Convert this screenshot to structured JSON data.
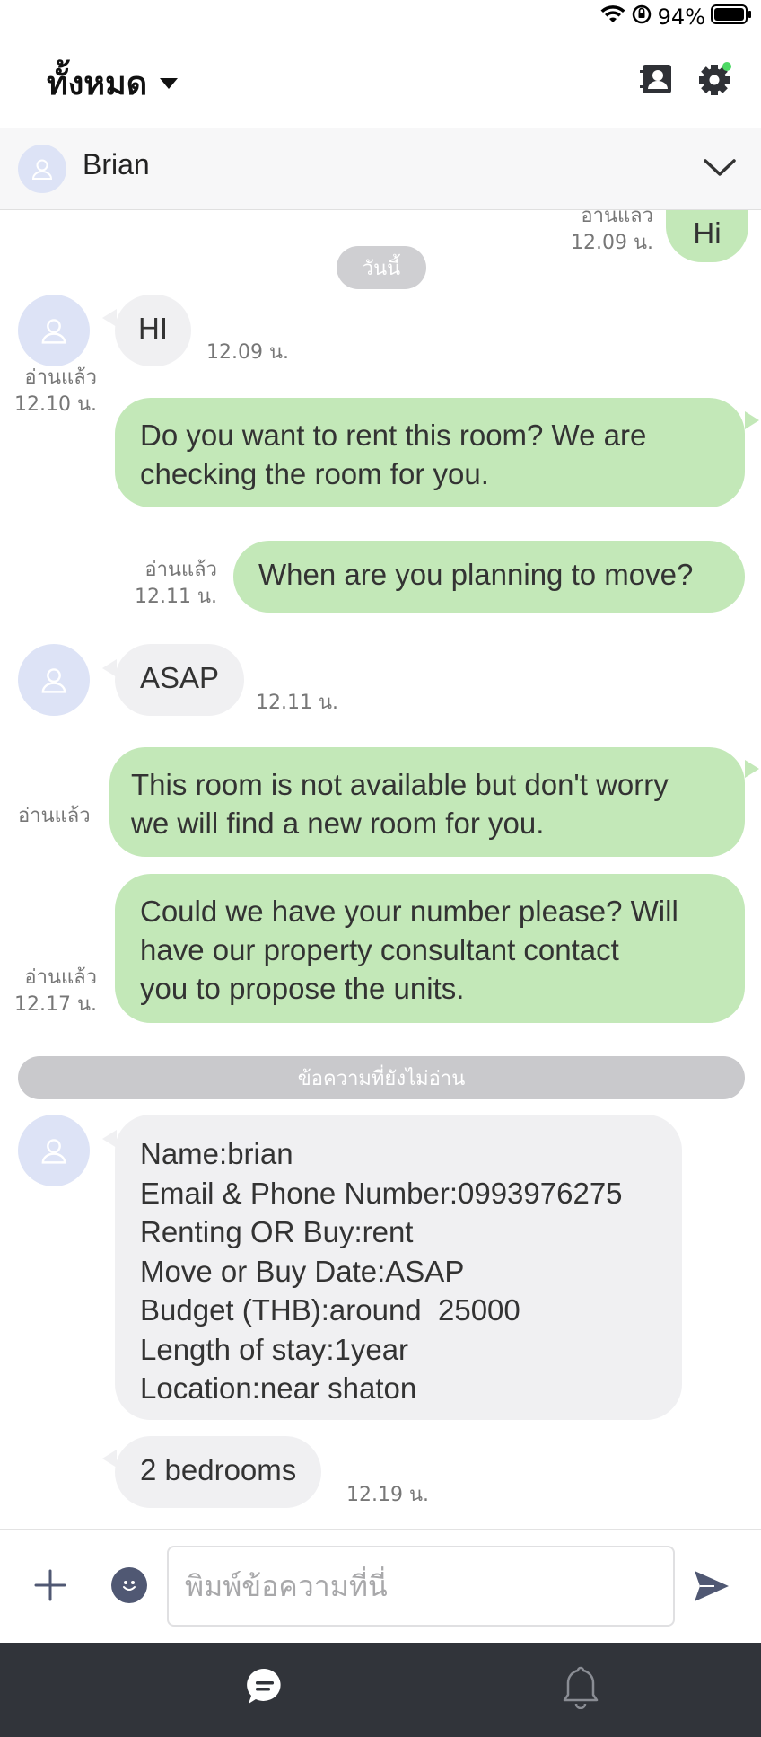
{
  "status_bar": {
    "battery": "94%"
  },
  "header": {
    "title": "ทั้งหมด"
  },
  "contact": {
    "name": "Brian"
  },
  "chat": {
    "date_label": "วันนี้",
    "unread_label": "ข้อความที่ยังไม่อ่าน",
    "messages": [
      {
        "dir": "out",
        "text": "Hi",
        "read": "อ่านแล้ว",
        "time": "12.09 น."
      },
      {
        "dir": "in",
        "text": "HI",
        "time": "12.09 น."
      },
      {
        "dir": "out",
        "lines": [
          "Do you want to rent this room? We are",
          "checking the room for you."
        ],
        "read": "อ่านแล้ว",
        "time": "12.10 น."
      },
      {
        "dir": "out",
        "text": "When are you planning to move?",
        "read": "อ่านแล้ว",
        "time": "12.11 น."
      },
      {
        "dir": "in",
        "text": "ASAP",
        "time": "12.11 น."
      },
      {
        "dir": "out",
        "lines": [
          "This room is not available but don't worry",
          "we will find a new room for you."
        ],
        "read": "อ่านแล้ว"
      },
      {
        "dir": "out",
        "lines": [
          "Could we have your number please? Will",
          "have our property consultant contact",
          "you to propose the units."
        ],
        "read": "อ่านแล้ว",
        "time": "12.17 น."
      },
      {
        "dir": "in",
        "lines": [
          "Name:brian",
          "Email & Phone Number:0993976275",
          "Renting OR Buy:rent",
          "Move or Buy Date:ASAP",
          "Budget (THB):around  25000",
          "Length of stay:1year",
          "Location:near shaton"
        ]
      },
      {
        "dir": "in",
        "text": "2 bedrooms",
        "time": "12.19 น."
      }
    ]
  },
  "composer": {
    "placeholder": "พิมพ์ข้อความที่นี่"
  },
  "colors": {
    "out_bubble": "#c3e8b8",
    "in_bubble": "#f0f0f2",
    "avatar": "#dde3f6",
    "nav": "#31343a",
    "notify_dot": "#4cd964"
  },
  "icons": [
    "wifi-icon",
    "orientation-lock-icon",
    "battery-icon",
    "contacts-icon",
    "settings-gear-icon",
    "chevron-down-icon",
    "user-icon",
    "plus-icon",
    "emoji-icon",
    "send-icon",
    "chat-icon",
    "bell-icon"
  ]
}
